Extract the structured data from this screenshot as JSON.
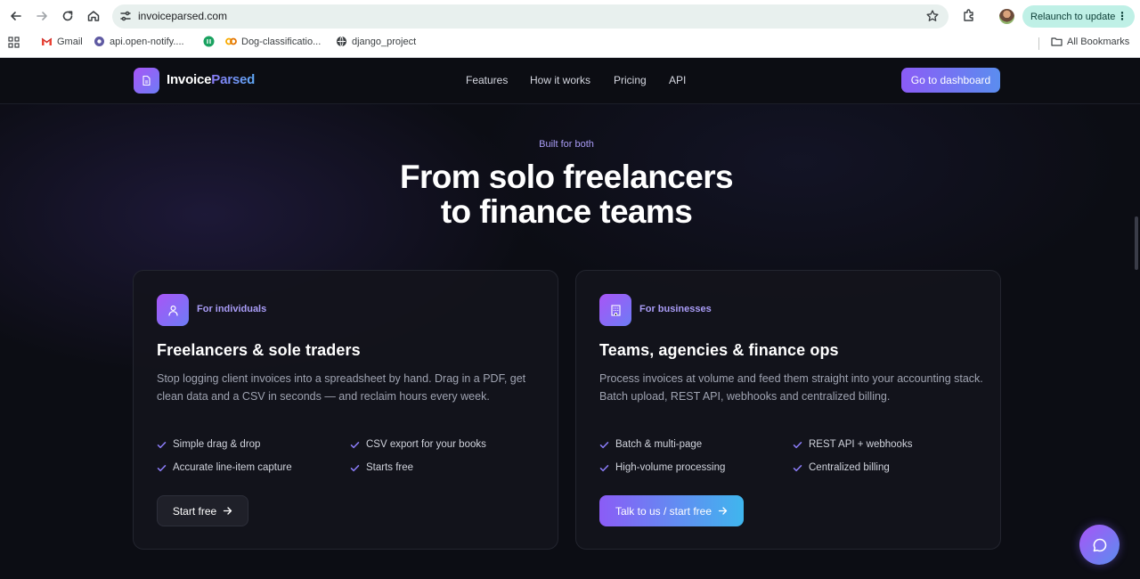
{
  "browser": {
    "url": "invoiceparsed.com",
    "relaunch_label": "Relaunch to update",
    "bookmarks": [
      {
        "label": "Gmail",
        "icon": "gmail-icon"
      },
      {
        "label": "api.open-notify....",
        "icon": "globe-icon"
      },
      {
        "label": "",
        "icon": "green-app-icon"
      },
      {
        "label": "Dog-classificatio...",
        "icon": "colab-icon"
      },
      {
        "label": "django_project",
        "icon": "globe-icon"
      }
    ],
    "all_bookmarks_label": "All Bookmarks"
  },
  "site": {
    "logo_main": "Invoice",
    "logo_accent": "Parsed",
    "nav": [
      "Features",
      "How it works",
      "Pricing",
      "API"
    ],
    "dashboard_label": "Go to dashboard"
  },
  "hero": {
    "eyebrow": "Built for both",
    "title_line1": "From solo freelancers",
    "title_line2": "to finance teams"
  },
  "cards": [
    {
      "tag": "For individuals",
      "icon": "user-icon",
      "title": "Freelancers & sole traders",
      "description": "Stop logging client invoices into a spreadsheet by hand. Drag in a PDF, get clean data and a CSV in seconds — and reclaim hours every week.",
      "features": [
        "Simple drag & drop",
        "CSV export for your books",
        "Accurate line-item capture",
        "Starts free"
      ],
      "cta": "Start free"
    },
    {
      "tag": "For businesses",
      "icon": "building-icon",
      "title": "Teams, agencies & finance ops",
      "description": "Process invoices at volume and feed them straight into your accounting stack. Batch upload, REST API, webhooks and centralized billing.",
      "features": [
        "Batch & multi-page",
        "REST API + webhooks",
        "High-volume processing",
        "Centralized billing"
      ],
      "cta": "Talk to us / start free"
    }
  ],
  "colors": {
    "accent_purple": "#8b5cf6",
    "accent_blue": "#5b8def",
    "page_bg": "#0c0d14"
  }
}
